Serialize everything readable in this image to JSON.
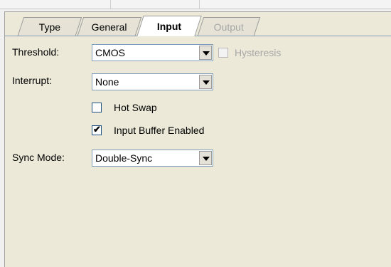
{
  "tabs": [
    {
      "label": "Type",
      "state": "normal"
    },
    {
      "label": "General",
      "state": "normal"
    },
    {
      "label": "Input",
      "state": "active"
    },
    {
      "label": "Output",
      "state": "disabled"
    }
  ],
  "form": {
    "threshold": {
      "label": "Threshold:",
      "value": "CMOS"
    },
    "hysteresis": {
      "label": "Hysteresis",
      "checked": false,
      "enabled": false
    },
    "interrupt": {
      "label": "Interrupt:",
      "value": "None"
    },
    "hot_swap": {
      "label": "Hot Swap",
      "checked": false
    },
    "input_buffer": {
      "label": "Input Buffer Enabled",
      "checked": true,
      "mark": "✔"
    },
    "sync_mode": {
      "label": "Sync Mode:",
      "value": "Double-Sync"
    }
  }
}
